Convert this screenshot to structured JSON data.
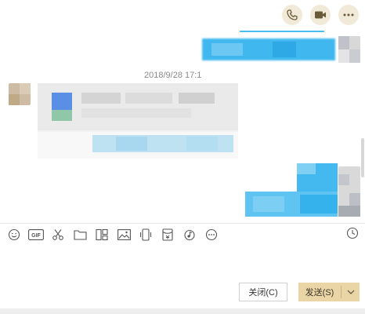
{
  "header": {
    "actions": [
      {
        "icon": "phone-icon"
      },
      {
        "icon": "video-camera-icon"
      },
      {
        "icon": "more-icon"
      }
    ]
  },
  "chat": {
    "timestamp": "2018/9/28 17:1",
    "content_state": "pixelated / redacted"
  },
  "toolbar": {
    "tools": [
      "emoji-icon",
      "gif-icon",
      "screenshot-icon",
      "folder-icon",
      "gallery-icon",
      "image-icon",
      "phone-shake-icon",
      "red-packet-icon",
      "music-icon",
      "more-tools-icon"
    ],
    "history_icon": "history-clock-icon"
  },
  "footer": {
    "close_label": "关闭(C)",
    "send_label": "发送(S)"
  },
  "colors": {
    "accent": "#e9d5a6",
    "header_button_bg": "#f1ead8",
    "icon_stroke": "#555555",
    "blur_blue": "#3fb9f0",
    "blur_gray": "#e7e7e7"
  }
}
